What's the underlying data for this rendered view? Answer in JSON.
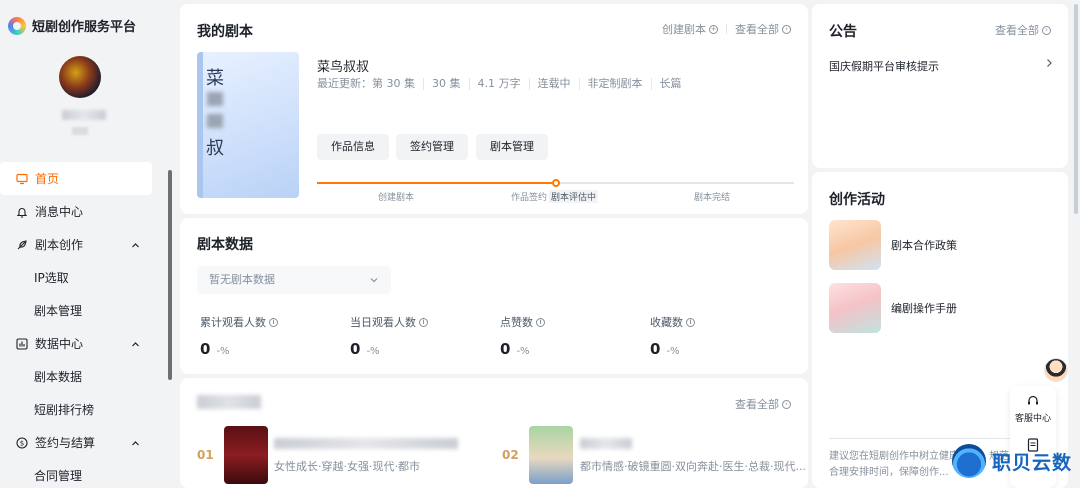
{
  "brand": {
    "name": "短剧创作服务平台"
  },
  "sidebar": {
    "items": [
      {
        "label": "首页",
        "icon": "monitor-icon",
        "active": true
      },
      {
        "label": "消息中心",
        "icon": "bell-icon"
      },
      {
        "label": "剧本创作",
        "icon": "feather-icon",
        "expandable": true
      },
      {
        "label": "IP选取",
        "sub": true
      },
      {
        "label": "剧本管理",
        "sub": true
      },
      {
        "label": "数据中心",
        "icon": "bar-chart-icon",
        "expandable": true
      },
      {
        "label": "剧本数据",
        "sub": true
      },
      {
        "label": "短剧排行榜",
        "sub": true
      },
      {
        "label": "签约与结算",
        "icon": "dollar-icon",
        "expandable": true
      },
      {
        "label": "合同管理",
        "sub": true
      }
    ]
  },
  "my_scripts": {
    "title": "我的剧本",
    "create_link": "创建剧本",
    "view_all": "查看全部",
    "cover_chars": [
      "菜",
      "叔"
    ],
    "script_name": "菜鸟叔叔",
    "meta": [
      "最近更新：第 30 集",
      "30 集",
      "4.1 万字",
      "连载中",
      "非定制剧本",
      "长篇"
    ],
    "buttons": [
      "作品信息",
      "签约管理",
      "剧本管理"
    ],
    "steps": [
      "创建剧本",
      "作品签约",
      "剧本评估中",
      "剧本完结"
    ],
    "progress": 0.5
  },
  "script_data": {
    "title": "剧本数据",
    "select_placeholder": "暂无剧本数据",
    "metrics": [
      {
        "label": "累计观看人数",
        "value": "0",
        "pct": "-%"
      },
      {
        "label": "当日观看人数",
        "value": "0",
        "pct": "-%"
      },
      {
        "label": "点赞数",
        "value": "0",
        "pct": "-%"
      },
      {
        "label": "收藏数",
        "value": "0",
        "pct": "-%"
      }
    ]
  },
  "ranking": {
    "view_all": "查看全部",
    "items": [
      {
        "rank": "01",
        "tags": "女性成长·穿越·女强·现代·都市"
      },
      {
        "rank": "02",
        "tags": "都市情感·破镜重圆·双向奔赴·医生·总裁·现代..."
      }
    ]
  },
  "announcement": {
    "title": "公告",
    "view_all": "查看全部",
    "item": "国庆假期平台审核提示"
  },
  "activities": {
    "title": "创作活动",
    "items": [
      "剧本合作政策",
      "编剧操作手册"
    ],
    "tips": "建议您在短剧创作中树立健康意识，规范度，合理安排时间，保障创作..."
  },
  "floating": {
    "service": "客服中心"
  },
  "watermark": {
    "text": "职贝云数"
  }
}
